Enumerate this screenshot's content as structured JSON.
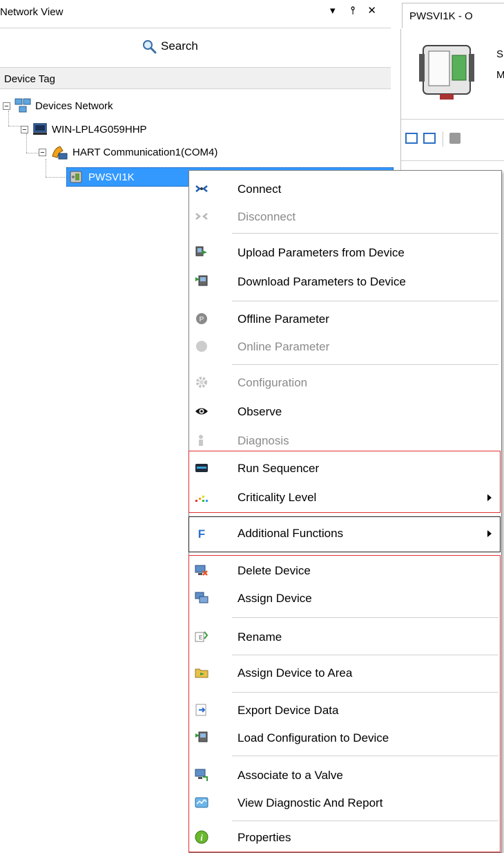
{
  "network_view": {
    "title": "Network View",
    "controls": "▾  P ✕",
    "search_label": "Search",
    "column_header": "Device Tag",
    "tree": {
      "root": "Devices Network",
      "computer": "WIN-LPL4G059HHP",
      "comm": "HART Communication1(COM4)",
      "device": "PWSVI1K"
    }
  },
  "right_panel": {
    "tab_label": "PWSVI1K - O",
    "text_s": "S",
    "text_m": "M"
  },
  "context_menu": {
    "items": [
      {
        "label": "Connect",
        "icon": "connect-icon",
        "disabled": false
      },
      {
        "label": "Disconnect",
        "icon": "disconnect-icon",
        "disabled": true
      },
      {
        "label": "Upload Parameters from Device",
        "icon": "upload-icon",
        "disabled": false
      },
      {
        "label": "Download Parameters to Device",
        "icon": "download-icon",
        "disabled": false
      },
      {
        "label": "Offline Parameter",
        "icon": "offline-parameter-icon",
        "disabled": false
      },
      {
        "label": "Online Parameter",
        "icon": "online-parameter-icon",
        "disabled": true
      },
      {
        "label": "Configuration",
        "icon": "configuration-icon",
        "disabled": true
      },
      {
        "label": "Observe",
        "icon": "eye-icon",
        "disabled": false
      },
      {
        "label": "Diagnosis",
        "icon": "diagnosis-icon",
        "disabled": true
      },
      {
        "label": "Run Sequencer",
        "icon": "sequencer-icon",
        "disabled": false
      },
      {
        "label": "Criticality Level",
        "icon": "criticality-icon",
        "disabled": false,
        "submenu": true
      },
      {
        "label": "Additional Functions",
        "icon": "functions-icon",
        "disabled": false,
        "submenu": true
      },
      {
        "label": "Delete Device",
        "icon": "delete-device-icon",
        "disabled": false
      },
      {
        "label": "Assign Device",
        "icon": "assign-device-icon",
        "disabled": false
      },
      {
        "label": "Rename",
        "icon": "rename-icon",
        "disabled": false
      },
      {
        "label": "Assign Device to Area",
        "icon": "folder-icon",
        "disabled": false
      },
      {
        "label": "Export Device Data",
        "icon": "export-icon",
        "disabled": false
      },
      {
        "label": "Load Configuration to Device",
        "icon": "load-config-icon",
        "disabled": false
      },
      {
        "label": "Associate to a Valve",
        "icon": "valve-icon",
        "disabled": false
      },
      {
        "label": "View Diagnostic And Report",
        "icon": "report-icon",
        "disabled": false
      },
      {
        "label": "Properties",
        "icon": "info-icon",
        "disabled": false
      }
    ]
  },
  "colors": {
    "selection": "#3399ff",
    "highlight_red": "#e03030"
  }
}
